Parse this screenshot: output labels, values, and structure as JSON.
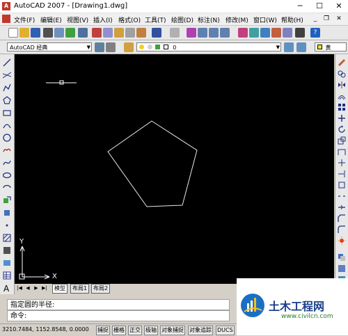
{
  "window": {
    "title": "AutoCAD 2007 - [Drawing1.dwg]",
    "minimize": "─",
    "maximize": "☐",
    "close": "✕"
  },
  "menubar": {
    "items": [
      "文件(F)",
      "编辑(E)",
      "视图(V)",
      "插入(I)",
      "格式(O)",
      "工具(T)",
      "绘图(D)",
      "标注(N)",
      "修改(M)",
      "窗口(W)",
      "帮助(H)"
    ],
    "doc_min": "_",
    "doc_restore": "❐",
    "doc_close": "✕"
  },
  "toolbar2": {
    "workspace": "AutoCAD 经典",
    "layer": "0",
    "color": "黄"
  },
  "canvas": {
    "background": "#000000",
    "shape_color": "#e8e8e8"
  },
  "ucs": {
    "x_label": "X",
    "y_label": "Y"
  },
  "layout_tabs": {
    "nav": [
      "|◀",
      "◀",
      "▶",
      "▶|"
    ],
    "tabs": [
      "模型",
      "布局1",
      "布局2"
    ]
  },
  "command": {
    "history": "指定圆的半径:",
    "prompt": "命令:"
  },
  "status": {
    "coords": "3210.7484,  1152.8548,  0.0000",
    "buttons": [
      "捕捉",
      "栅格",
      "正交",
      "极轴",
      "对象捕捉",
      "对象追踪",
      "DUCS"
    ]
  },
  "watermark": {
    "name": "土木工程网",
    "url": "www.civilcn.com"
  }
}
